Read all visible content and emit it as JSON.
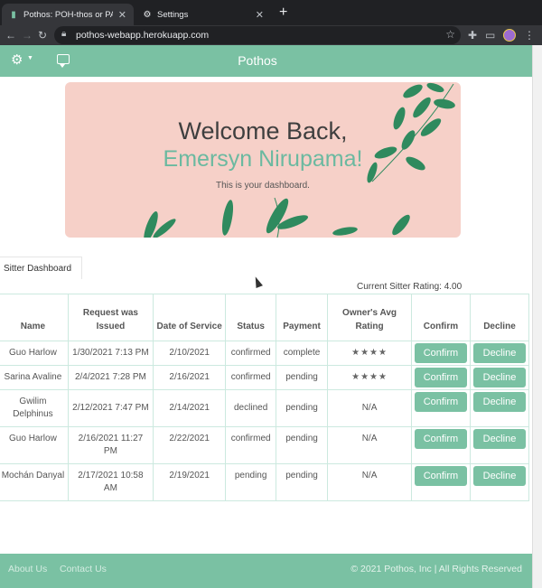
{
  "browser": {
    "tabs": [
      {
        "title": "Pothos: POH-thos or PAH-thos",
        "active": true
      },
      {
        "title": "Settings",
        "active": false
      }
    ],
    "url": "pothos-webapp.herokuapp.com"
  },
  "navbar": {
    "title": "Pothos",
    "color": "#7ac1a3"
  },
  "hero": {
    "greeting": "Welcome Back,",
    "name": "Emersyn Nirupama!",
    "subtitle": "This is your dashboard.",
    "background": "#f6d0c8"
  },
  "dashboard": {
    "tab_label": "Sitter Dashboard",
    "rating_text": "Current Sitter Rating: 4.00"
  },
  "table": {
    "headers": [
      "Name",
      "Request was Issued",
      "Date of Service",
      "Status",
      "Payment",
      "Owner's Avg Rating",
      "Confirm",
      "Decline"
    ],
    "rows": [
      {
        "name": "Guo Harlow",
        "issued": "1/30/2021 7:13 PM",
        "service": "2/10/2021",
        "status": "confirmed",
        "payment": "complete",
        "rating": "★★★★",
        "confirm": "Confirm",
        "decline": "Decline"
      },
      {
        "name": "Sarina Avaline",
        "issued": "2/4/2021 7:28 PM",
        "service": "2/16/2021",
        "status": "confirmed",
        "payment": "pending",
        "rating": "★★★★",
        "confirm": "Confirm",
        "decline": "Decline"
      },
      {
        "name": "Gwilim Delphinus",
        "issued": "2/12/2021 7:47 PM",
        "service": "2/14/2021",
        "status": "declined",
        "payment": "pending",
        "rating": "N/A",
        "confirm": "Confirm",
        "decline": "Decline"
      },
      {
        "name": "Guo Harlow",
        "issued": "2/16/2021 11:27 PM",
        "service": "2/22/2021",
        "status": "confirmed",
        "payment": "pending",
        "rating": "N/A",
        "confirm": "Confirm",
        "decline": "Decline"
      },
      {
        "name": "Mochán Danyal",
        "issued": "2/17/2021 10:58 AM",
        "service": "2/19/2021",
        "status": "pending",
        "payment": "pending",
        "rating": "N/A",
        "confirm": "Confirm",
        "decline": "Decline"
      }
    ]
  },
  "footer": {
    "about": "About Us",
    "contact": "Contact Us",
    "copyright": "© 2021 Pothos, Inc | All Rights Reserved"
  }
}
